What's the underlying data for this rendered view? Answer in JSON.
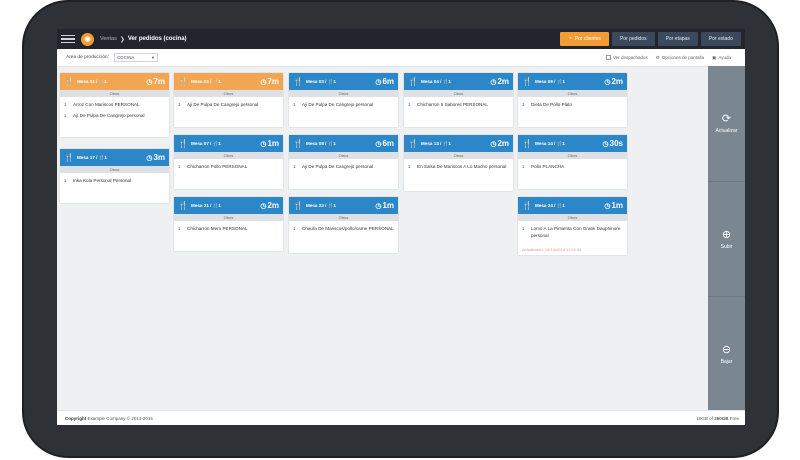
{
  "header": {
    "breadcrumb_root": "Ventas",
    "breadcrumb_sep": "❯",
    "breadcrumb_current": "Ver pedidos (cocina)",
    "buttons": [
      {
        "label": "Por clientes",
        "active": true
      },
      {
        "label": "Por pedidos",
        "active": false
      },
      {
        "label": "Por etapas",
        "active": false
      },
      {
        "label": "Por estado",
        "active": false
      }
    ]
  },
  "filter": {
    "label": "Area de producción:",
    "selected": "COCINA",
    "show_dispatched": "Ver despachados",
    "screen_options": "Opciones de pantalla",
    "help": "Ayuda"
  },
  "colors": {
    "blue": "#2b87c8",
    "orange": "#f2a652",
    "side_panel": "#7a8791"
  },
  "orders": [
    {
      "title": "Mesa 01 / 🍴1",
      "time": "7m",
      "color": "orange",
      "category": "Otros",
      "items": [
        {
          "qty": "1",
          "name": "Arroz Con Mariscos PERSONAL"
        },
        {
          "qty": "1",
          "name": "Ají De Pulpa De Cangrejo personal"
        }
      ]
    },
    {
      "title": "Mesa 17 / 🍴1",
      "time": "3m",
      "color": "blue",
      "category": "Otros",
      "items": [
        {
          "qty": "1",
          "name": "Inka Kola Personal Personal"
        }
      ]
    },
    {
      "title": "Mesa 02 / 🍴1",
      "time": "7m",
      "color": "orange",
      "category": "Otros",
      "items": [
        {
          "qty": "1",
          "name": "Aji De Pulpa De Cangrejo personal"
        }
      ]
    },
    {
      "title": "Mesa 07 / 🍴1",
      "time": "1m",
      "color": "blue",
      "category": "Otros",
      "items": [
        {
          "qty": "1",
          "name": "Chicharron Pollo PERSONAL"
        }
      ]
    },
    {
      "title": "Mesa 21 / 🍴1",
      "time": "2m",
      "color": "blue",
      "category": "Otros",
      "items": [
        {
          "qty": "1",
          "name": "Chicharron Mero PERSONAL"
        }
      ]
    },
    {
      "title": "Mesa 03 / 🍴1",
      "time": "6m",
      "color": "blue",
      "category": "Otros",
      "items": [
        {
          "qty": "1",
          "name": "Aji De Pulpa De Cangrejo personal"
        }
      ]
    },
    {
      "title": "Mesa 08 / 🍴1",
      "time": "6m",
      "color": "blue",
      "category": "Otros",
      "items": [
        {
          "qty": "1",
          "name": "Aji De Pulpa De Cangrejo personal"
        }
      ]
    },
    {
      "title": "Mesa 22 / 🍴1",
      "time": "1m",
      "color": "blue",
      "category": "Otros",
      "items": [
        {
          "qty": "1",
          "name": "Chaufa De Mariscos/pollo/carne PERSONAL"
        }
      ]
    },
    {
      "title": "Mesa 04 / 🍴1",
      "time": "2m",
      "color": "blue",
      "category": "Otros",
      "items": [
        {
          "qty": "1",
          "name": "Chicharron 5 Sabores PERSONAL"
        }
      ]
    },
    {
      "title": "Mesa 13 / 🍴1",
      "time": "2m",
      "color": "blue",
      "category": "Otros",
      "items": [
        {
          "qty": "1",
          "name": "En Salsa De Mariscos A Lo Macho personal"
        }
      ]
    },
    {
      "title": "Mesa 09 / 🍴1",
      "time": "2m",
      "color": "blue",
      "category": "Otros",
      "items": [
        {
          "qty": "1",
          "name": "Dieta De Pollo Plato"
        }
      ]
    },
    {
      "title": "Mesa 14 / 🍴1",
      "time": "30s",
      "color": "blue",
      "category": "Otros",
      "items": [
        {
          "qty": "1",
          "name": "Pollo PLANCHA"
        }
      ]
    },
    {
      "title": "Mesa 24 / 🍴1",
      "time": "1m",
      "color": "blue",
      "category": "Otros",
      "items": [
        {
          "qty": "1",
          "name": "Lomo A La Pimienta Con Gratin Dauphinore personal"
        }
      ],
      "footer": "Actualizado: 16/10/2018 11:04:44"
    }
  ],
  "side": {
    "refresh": "Actualizar",
    "up": "Subir",
    "down": "Bajar"
  },
  "footer": {
    "copyright_label": "Copyright",
    "copyright_text": "Example Company © 2014-2015",
    "storage_used": "10GB",
    "storage_of": "of",
    "storage_total": "250GB",
    "storage_free": "Free"
  }
}
